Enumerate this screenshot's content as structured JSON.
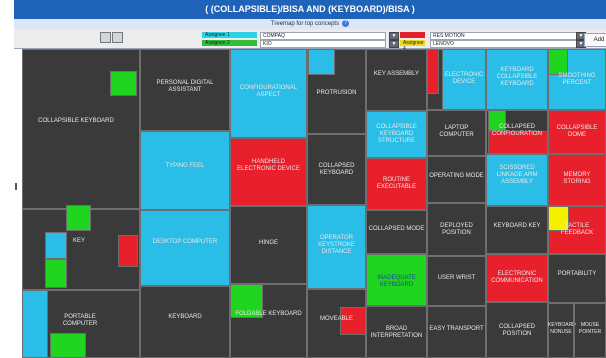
{
  "window": {
    "title": "( (COLLAPSIBLE)/BISA AND (KEYBOARD)/BISA )",
    "subtitle": "Treemap for top concepts"
  },
  "toolbar": {
    "assignee1_label": "Assignee 1",
    "assignee1_value": "COMPAQ",
    "assignee2_label": "Assignee 2",
    "assignee2_value": "KIO",
    "assignee3_label": "Assignee 3",
    "assignee3_value": "RES MOTION",
    "assignee4_label": "Assignee 4",
    "assignee4_value": "LENOVO",
    "add_label": "Add",
    "dropdown_glyph": "▼"
  },
  "colors": {
    "assignee1": "#2bd3e6",
    "assignee2": "#2fbd3a",
    "assignee3": "#e0202a",
    "assignee4": "#f0d818",
    "title_bg": "#1f63b8",
    "cell_bg": "#3a3a3a",
    "blue": "#29bde8",
    "green": "#1fd51f",
    "red": "#e8202c",
    "yellow": "#f5f000"
  },
  "treemap": {
    "labels": {
      "collapsible_keyboard": "COLLAPSIBLE KEYBOARD",
      "key": "KEY",
      "portable_computer": "PORTABLE COMPUTER",
      "personal_digital_assistant": "PERSONAL DIGITAL ASSISTANT",
      "typing_feel": "TYPING FEEL",
      "desktop_computer": "DESKTOP COMPUTER",
      "keyboard": "KEYBOARD",
      "configurational_aspect": "CONFIGURATIONAL ASPECT",
      "protrusion": "PROTRUSION",
      "handheld_electronic_device": "HANDHELD ELECTRONIC DEVICE",
      "hinge": "HINGE",
      "foldable_keyboard": "FOLDABLE KEYBOARD",
      "collapsed_keyboard": "COLLAPSED KEYBOARD",
      "operator_keystroke_distance": "OPERATOR KEYSTROKE DISTANCE",
      "moveable": "MOVEABLE",
      "key_assembly": "KEY ASSEMBLY",
      "electronic_device": "ELECTRONIC DEVICE",
      "collapsible_keyboard_structure": "COLLAPSIBLE KEYBOARD STRUCTURE",
      "routine_executable": "ROUTINE EXECUTABLE",
      "collapsed_mode": "COLLAPSED MODE",
      "inadequate_keyboard": "INADEQUATE KEYBOARD",
      "broad_interpretation": "BROAD INTERPRETATION",
      "laptop_computer": "LAPTOP COMPUTER",
      "operating_mode": "OPERATING MODE",
      "deployed_position": "DEPLOYED POSITION",
      "user_wrist": "USER WRIST",
      "easy_transport": "EASY TRANSPORT",
      "keyboard_collapsible_keyboard": "KEYBOARD COLLAPSIBLE KEYBOARD",
      "collapsed_configuration": "COLLAPSED CONFIGURATION",
      "scissored_linkage_arm_assembly": "SCISSORED LINKAGE ARM ASSEMBLY",
      "keyboard_key": "KEYBOARD KEY",
      "electronic_communication": "ELECTRONIC COMMUNICATION",
      "collapsed_position": "COLLAPSED POSITION",
      "smoothing_percent": "SMOOTHING PERCENT",
      "collapsible_dome": "COLLAPSIBLE DOME",
      "memory_storing": "MEMORY STORING",
      "tactile_feedback": "TACTILE FEEDBACK",
      "portability": "PORTABILITY",
      "keyboard_nonuse": "KEYBOARD NONUSE",
      "mouse_pointer": "MOUSE POINTER"
    }
  }
}
